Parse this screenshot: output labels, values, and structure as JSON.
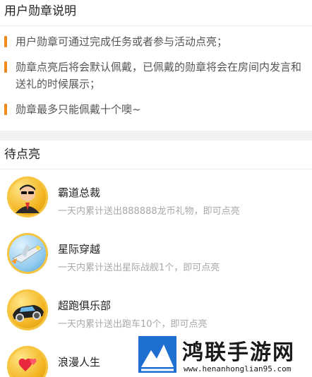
{
  "intro": {
    "title": "用户勋章说明",
    "rules": [
      "用户勋章可通过完成任务或者参与活动点亮；",
      "勋章点亮后将会默认佩戴，已佩戴的勋章将会在房间内发言和送礼的时候展示；",
      "勋章最多只能佩戴十个噢~"
    ]
  },
  "pending": {
    "title": "待点亮",
    "badges": [
      {
        "name": "霸道总裁",
        "desc": "一天内累计送出888888龙币礼物，即可点亮",
        "icon": "boss-avatar-icon"
      },
      {
        "name": "星际穿越",
        "desc": "一天内累计送出星际战舰1个，即可点亮",
        "icon": "spaceship-icon"
      },
      {
        "name": "超跑俱乐部",
        "desc": "一天内累计送出跑车10个，即可点亮",
        "icon": "sports-car-icon"
      },
      {
        "name": "浪漫人生",
        "desc": "",
        "icon": "hearts-icon"
      }
    ]
  },
  "watermark": {
    "brand": "鸿联手游网",
    "url": "www.henanhonglian95.com"
  },
  "colors": {
    "accent": "#f08a1c",
    "badge_gold": "#f3b21e",
    "muted_text": "#a8a8a8"
  }
}
